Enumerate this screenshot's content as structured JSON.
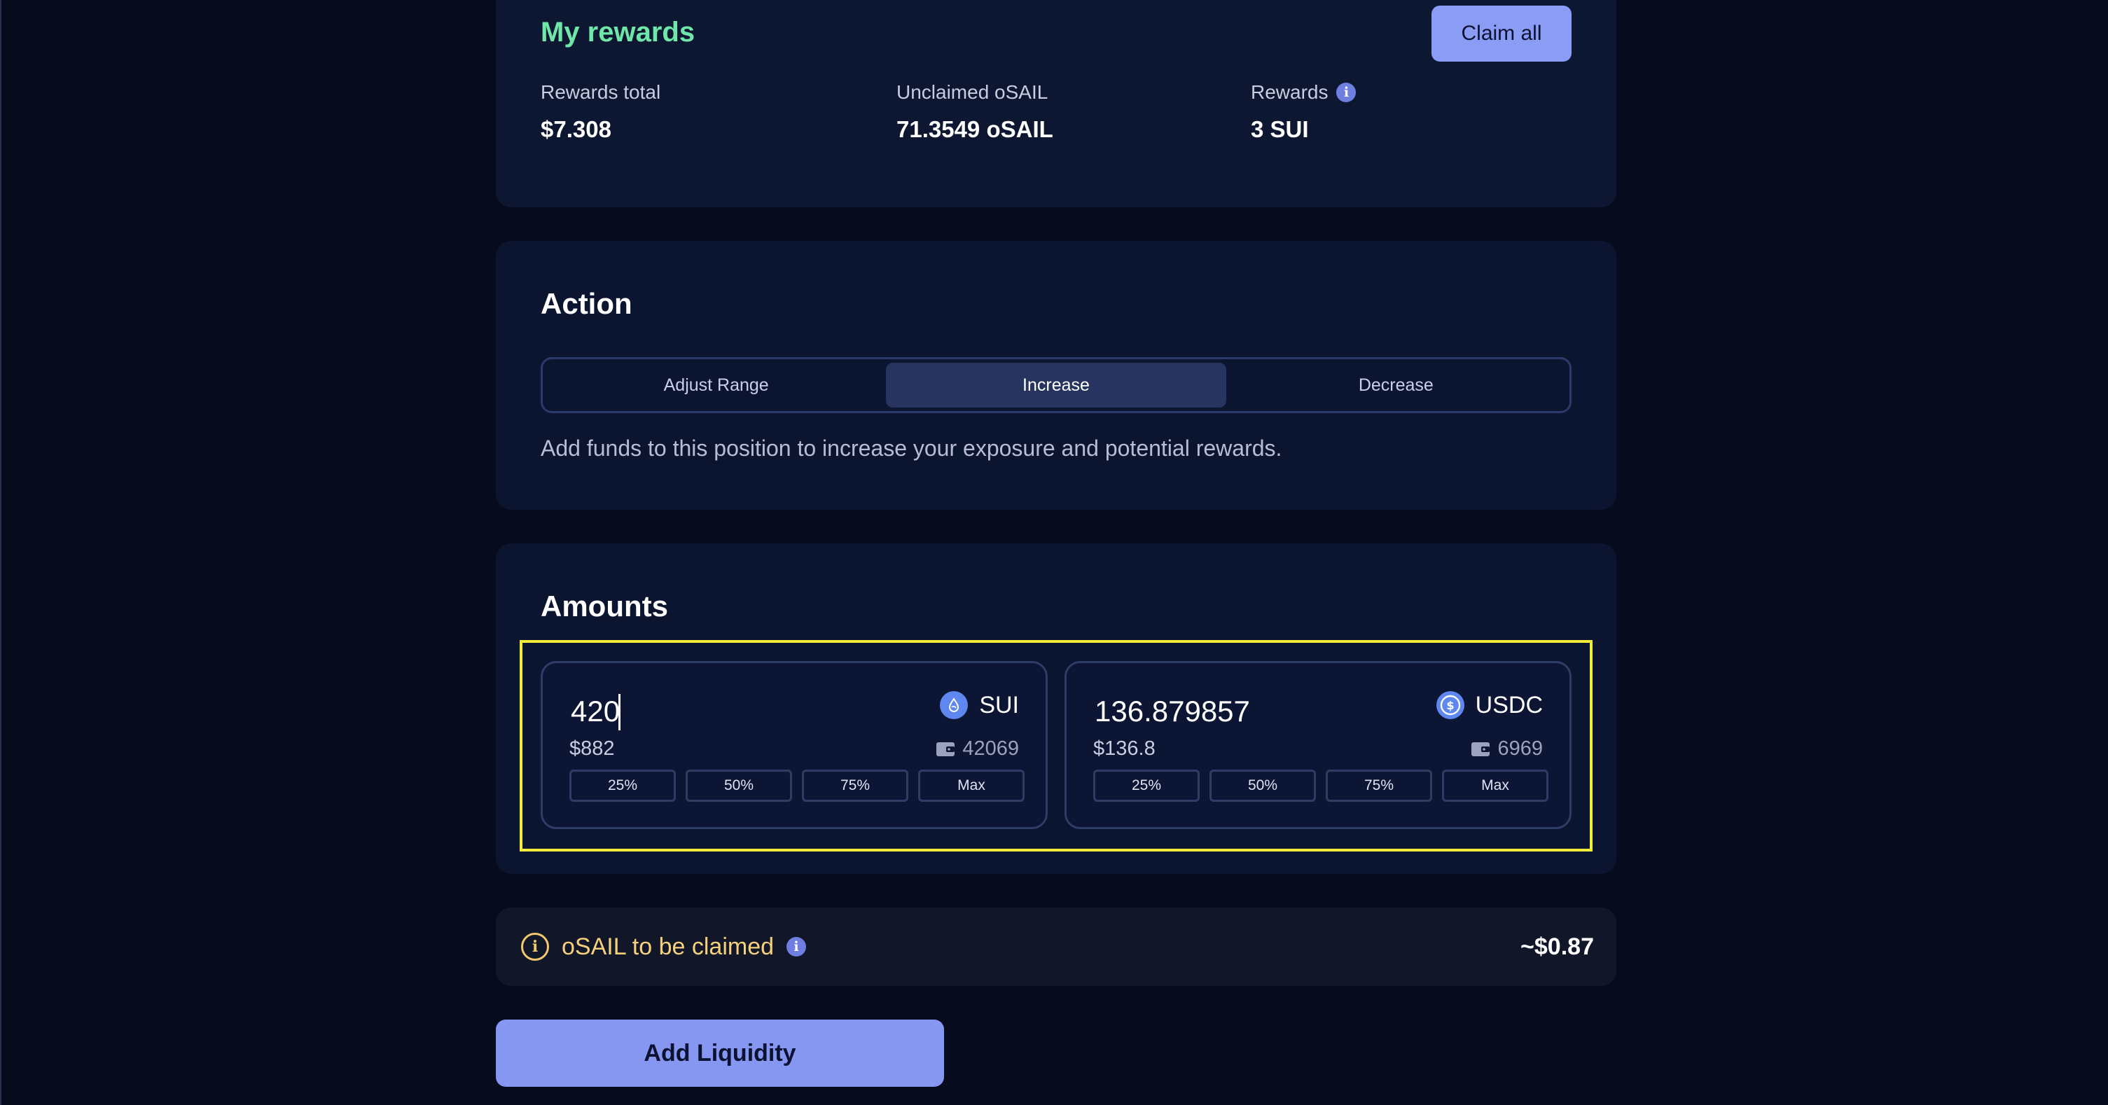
{
  "rewards": {
    "title": "My rewards",
    "claim_label": "Claim all",
    "stats": [
      {
        "label": "Rewards total",
        "value": "$7.308"
      },
      {
        "label": "Unclaimed oSAIL",
        "value": "71.3549 oSAIL"
      },
      {
        "label": "Rewards",
        "value": "3 SUI"
      }
    ]
  },
  "action": {
    "title": "Action",
    "tabs": [
      {
        "label": "Adjust Range"
      },
      {
        "label": "Increase",
        "active": true
      },
      {
        "label": "Decrease"
      }
    ],
    "description": "Add funds to this position to increase your exposure and potential rewards."
  },
  "amounts": {
    "title": "Amounts",
    "tokens": [
      {
        "symbol": "SUI",
        "amount": "420",
        "usd": "$882",
        "balance": "42069",
        "icon": "sui-drop-icon"
      },
      {
        "symbol": "USDC",
        "amount": "136.879857",
        "usd": "$136.8",
        "balance": "6969",
        "icon": "usdc-dollar-icon"
      }
    ],
    "percent_buttons": [
      "25%",
      "50%",
      "75%",
      "Max"
    ]
  },
  "osail": {
    "label": "oSAIL to be claimed",
    "value": "~$0.87"
  },
  "add_liquidity_label": "Add Liquidity",
  "colors": {
    "accent": "#8b9cf4",
    "rewards_title": "#6ee7a8",
    "osail_label": "#f6d17a",
    "highlight": "#f2ec3a"
  }
}
